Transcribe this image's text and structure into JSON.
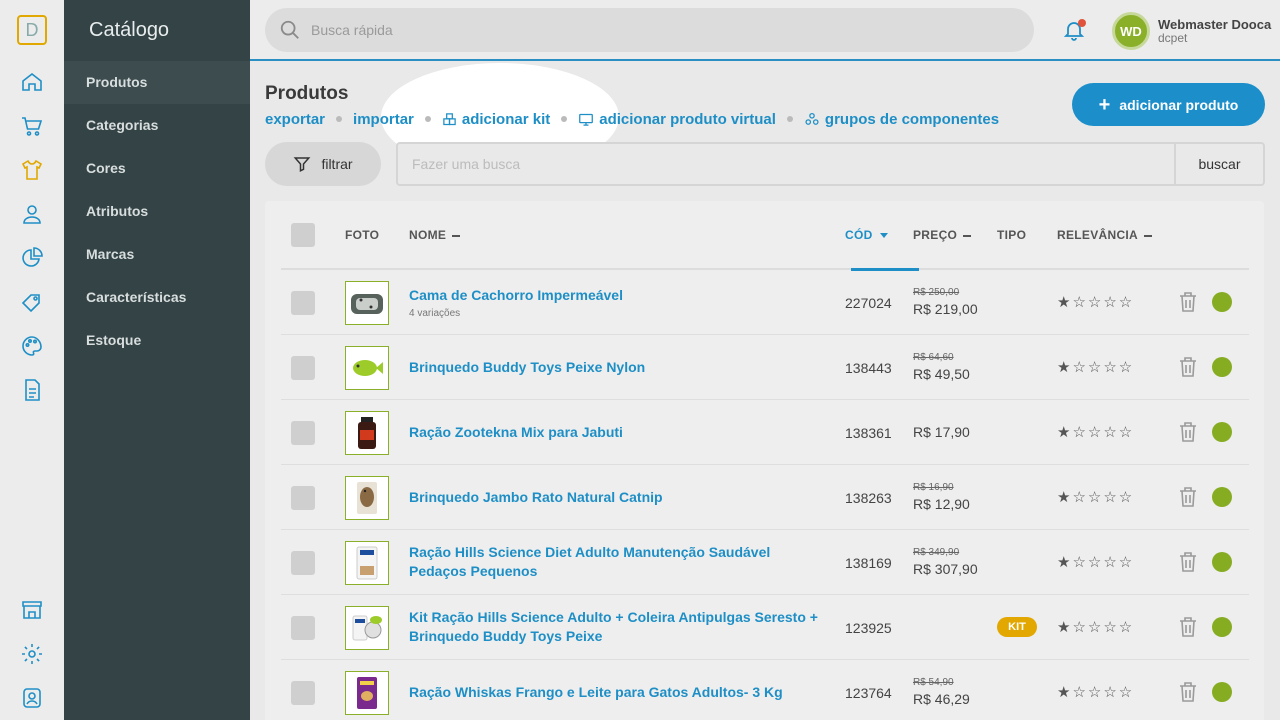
{
  "app": {
    "logo_letter": "D"
  },
  "rail": {
    "icons": [
      "home-icon",
      "cart-icon",
      "shirt-icon",
      "customer-icon",
      "report-chart-icon",
      "tag-icon",
      "palette-icon",
      "document-icon",
      "store-icon",
      "settings-gear-icon",
      "user-lock-icon"
    ]
  },
  "sidebar": {
    "title": "Catálogo",
    "items": [
      {
        "label": "Produtos",
        "active": true
      },
      {
        "label": "Categorias"
      },
      {
        "label": "Cores"
      },
      {
        "label": "Atributos"
      },
      {
        "label": "Marcas"
      },
      {
        "label": "Características"
      },
      {
        "label": "Estoque"
      }
    ]
  },
  "topbar": {
    "search_placeholder": "Busca rápida",
    "user": {
      "initials": "WD",
      "name": "Webmaster Dooca",
      "store": "dcpet"
    }
  },
  "page": {
    "title": "Produtos",
    "actions": {
      "export": "exportar",
      "import": "importar",
      "add_kit": "adicionar kit",
      "add_virtual": "adicionar produto virtual",
      "component_groups": "grupos de componentes"
    },
    "add_product": "adicionar produto",
    "filter": "filtrar",
    "query_placeholder": "Fazer uma busca",
    "search_button": "buscar"
  },
  "table": {
    "headers": {
      "photo": "FOTO",
      "name": "NOME",
      "code": "CÓD",
      "price": "PREÇO",
      "type": "TIPO",
      "relevance": "RELEVÂNCIA"
    },
    "rows": [
      {
        "name": "Cama de Cachorro Impermeável",
        "variations": "4 variações",
        "code": "227024",
        "old_price": "R$ 250,00",
        "price": "R$ 219,00",
        "type": "",
        "rating": 1
      },
      {
        "name": "Brinquedo Buddy Toys Peixe Nylon",
        "variations": "",
        "code": "138443",
        "old_price": "R$ 64,60",
        "price": "R$ 49,50",
        "type": "",
        "rating": 1
      },
      {
        "name": "Ração Zootekna Mix para Jabuti",
        "variations": "",
        "code": "138361",
        "old_price": "",
        "price": "R$ 17,90",
        "type": "",
        "rating": 1
      },
      {
        "name": "Brinquedo Jambo Rato Natural Catnip",
        "variations": "",
        "code": "138263",
        "old_price": "R$ 16,90",
        "price": "R$ 12,90",
        "type": "",
        "rating": 1
      },
      {
        "name": "Ração Hills Science Diet Adulto Manutenção Saudável Pedaços Pequenos",
        "variations": "",
        "code": "138169",
        "old_price": "R$ 349,90",
        "price": "R$ 307,90",
        "type": "",
        "rating": 1
      },
      {
        "name": "Kit Ração Hills Science Adulto + Coleira Antipulgas Seresto + Brinquedo Buddy Toys Peixe",
        "variations": "",
        "code": "123925",
        "old_price": "",
        "price": "",
        "type": "KIT",
        "rating": 1
      },
      {
        "name": "Ração Whiskas Frango e Leite para Gatos Adultos- 3 Kg",
        "variations": "",
        "code": "123764",
        "old_price": "R$ 54,90",
        "price": "R$ 46,29",
        "type": "",
        "rating": 1
      }
    ]
  },
  "colors": {
    "accent": "#1e8fc6",
    "sidebar": "#334346",
    "status_active": "#86ac22",
    "kit_badge": "#e2a700"
  }
}
